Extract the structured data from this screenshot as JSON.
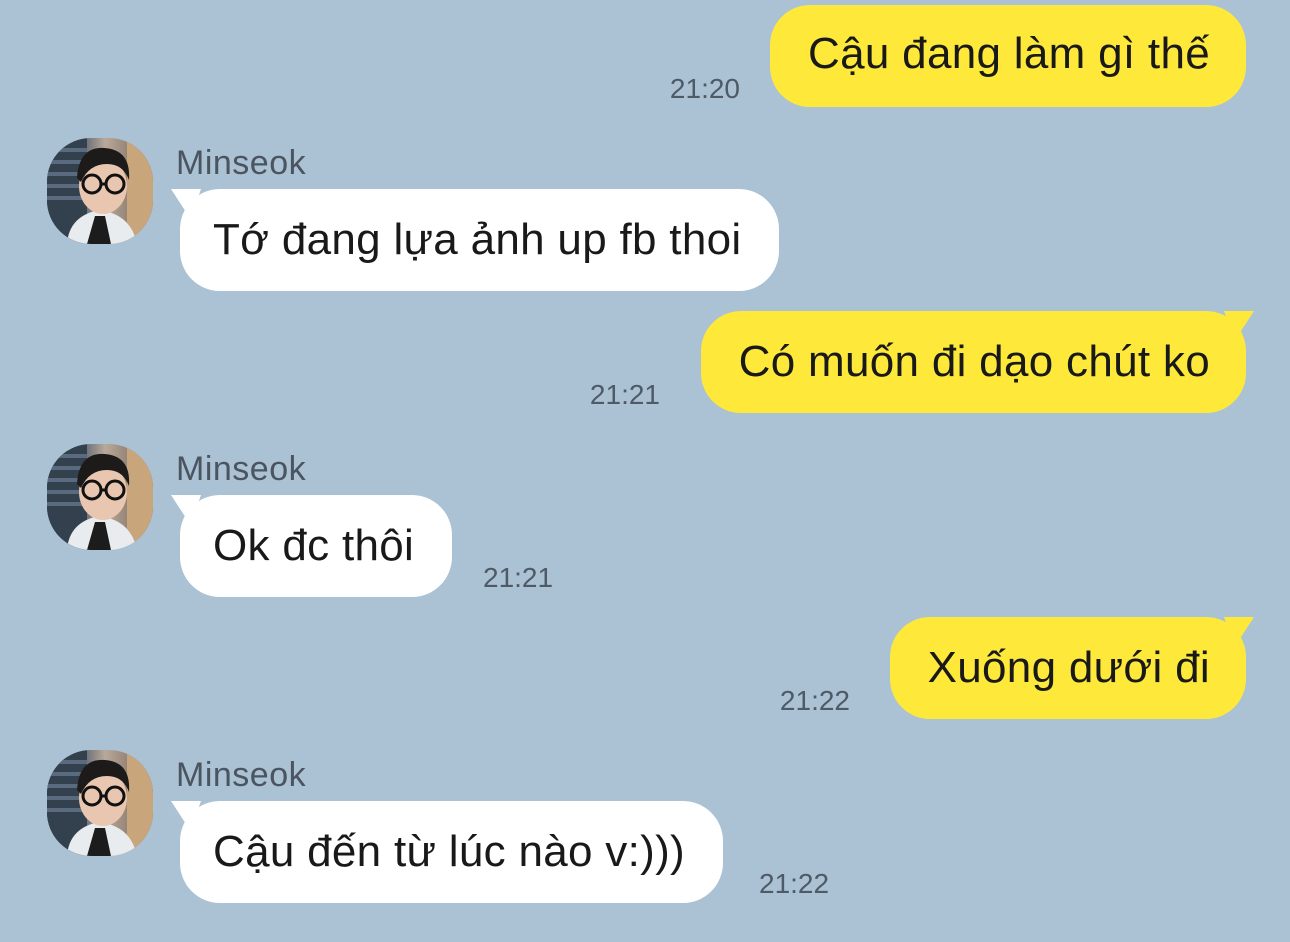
{
  "colors": {
    "background": "#abc1d4",
    "outgoing_bubble": "#fee93a",
    "incoming_bubble": "#ffffff",
    "timestamp": "#4e5a66"
  },
  "messages": [
    {
      "direction": "out",
      "text": "Cậu đang làm gì thế",
      "time": "21:20"
    },
    {
      "direction": "in",
      "sender": "Minseok",
      "avatar_icon": "person-with-glasses-photo",
      "text": "Tớ đang lựa ảnh up fb thoi",
      "time": ""
    },
    {
      "direction": "out",
      "text": "Có muốn đi dạo chút ko",
      "time": "21:21"
    },
    {
      "direction": "in",
      "sender": "Minseok",
      "avatar_icon": "person-with-glasses-photo",
      "text": "Ok đc thôi",
      "time": "21:21"
    },
    {
      "direction": "out",
      "text": "Xuống dưới đi",
      "time": "21:22"
    },
    {
      "direction": "in",
      "sender": "Minseok",
      "avatar_icon": "person-with-glasses-photo",
      "text": "Cậu đến từ lúc nào v:)))",
      "time": "21:22"
    }
  ]
}
